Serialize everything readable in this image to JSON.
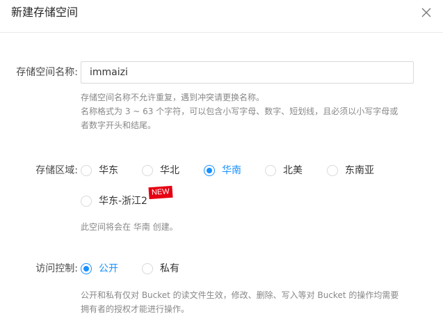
{
  "dialog": {
    "title": "新建存储空间"
  },
  "bucket_name": {
    "label": "存储空间名称:",
    "value": "immaizi",
    "help_line1": "存储空间名称不允许重复，遇到冲突请更换名称。",
    "help_line2": "名称格式为 3 ~ 63 个字符，可以包含小写字母、数字、短划线，且必须以小写字母或",
    "help_line3": "者数字开头和结尾。"
  },
  "region": {
    "label": "存储区域:",
    "options": [
      "华东",
      "华北",
      "华南",
      "北美",
      "东南亚",
      "华东-浙江2"
    ],
    "selected": "华南",
    "new_badge": "NEW",
    "note": "此空间将会在 华南 创建。"
  },
  "access": {
    "label": "访问控制:",
    "options": [
      "公开",
      "私有"
    ],
    "selected": "公开",
    "help_line1": "公开和私有仅对 Bucket 的读文件生效，修改、删除、写入等对 Bucket 的操作均需要",
    "help_line2": "拥有者的授权才能进行操作。"
  },
  "colors": {
    "accent": "#1890ff",
    "badge": "#e60012"
  }
}
